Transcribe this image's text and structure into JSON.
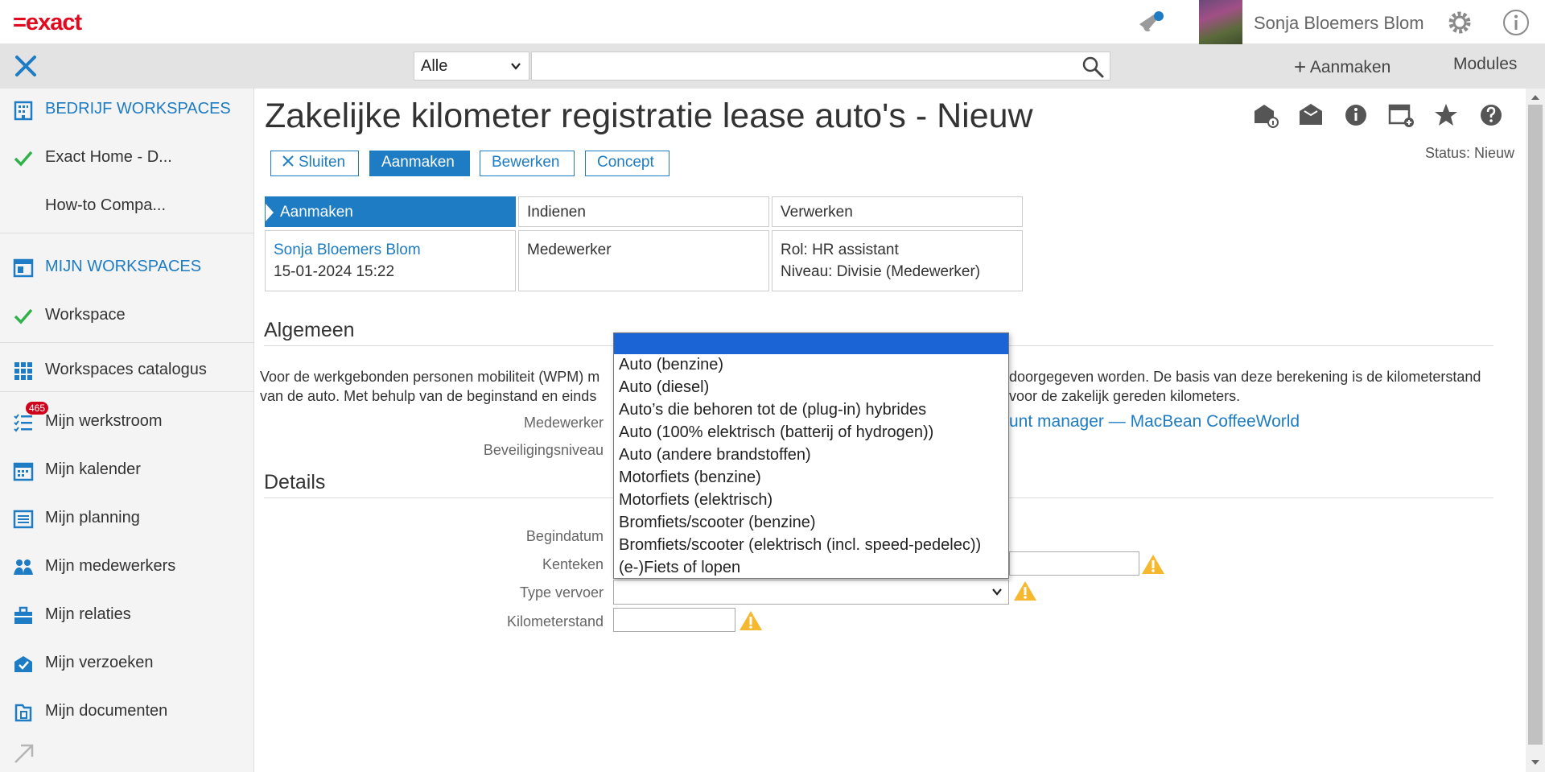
{
  "topbar": {
    "logo": "=exact",
    "user_name": "Sonja Bloemers Blom"
  },
  "navbar": {
    "scope_value": "Alle",
    "search_value": "",
    "create_label": "Aanmaken",
    "modules_label": "Modules"
  },
  "sidebar": {
    "company_workspaces": "BEDRIJF WORKSPACES",
    "exact_home": "Exact Home - D...",
    "howto": "How-to Compa...",
    "my_workspaces": "MIJN WORKSPACES",
    "workspace": "Workspace",
    "catalogue": "Workspaces catalogus",
    "workstream": "Mijn werkstroom",
    "workstream_badge": "465",
    "calendar": "Mijn kalender",
    "planning": "Mijn planning",
    "employees": "Mijn medewerkers",
    "relations": "Mijn relaties",
    "requests": "Mijn verzoeken",
    "documents": "Mijn documenten"
  },
  "page": {
    "title": "Zakelijke kilometer registratie lease auto's - Nieuw",
    "status": "Status: Nieuw",
    "buttons": {
      "close": "Sluiten",
      "create": "Aanmaken",
      "edit": "Bewerken",
      "draft": "Concept"
    }
  },
  "workflow": {
    "steps": [
      "Aanmaken",
      "Indienen",
      "Verwerken"
    ],
    "create_user": "Sonja Bloemers Blom",
    "create_date": "15-01-2024 15:22",
    "submit_role": "Medewerker",
    "process_role": "Rol: HR assistant",
    "process_level": "Niveau: Divisie (Medewerker)"
  },
  "general": {
    "heading": "Algemeen",
    "description_left_1": "Voor de werkgebonden personen mobiliteit (WPM) m",
    "description_right_1": "doorgegeven worden. De basis van deze berekening is de kilometerstand",
    "description_left_2": "van de auto. Met behulp van de beginstand en einds",
    "description_right_2": "voor de zakelijk gereden kilometers.",
    "employee_label": "Medewerker",
    "employee_value": "unt manager — MacBean CoffeeWorld",
    "security_label": "Beveiligingsniveau"
  },
  "details": {
    "heading": "Details",
    "start_date_label": "Begindatum",
    "plate_label": "Kenteken",
    "type_label": "Type vervoer",
    "type_value": "",
    "odometer_label": "Kilometerstand",
    "odometer_value": ""
  },
  "dropdown": {
    "options": [
      "",
      "Auto (benzine)",
      "Auto (diesel)",
      "Auto’s die behoren tot de (plug-in) hybrides",
      "Auto (100% elektrisch (batterij of hydrogen))",
      "Auto (andere brandstoffen)",
      "Motorfiets (benzine)",
      "Motorfiets (elektrisch)",
      "Bromfiets/scooter (benzine)",
      "Bromfiets/scooter (elektrisch (incl. speed-pedelec))",
      "(e-)Fiets of lopen"
    ]
  },
  "colors": {
    "brand_red": "#e10a1e",
    "accent_blue": "#1d7cc3",
    "check_green": "#2fb24a",
    "warning_yellow": "#f5b82e",
    "selected_option": "#1a64d6"
  }
}
